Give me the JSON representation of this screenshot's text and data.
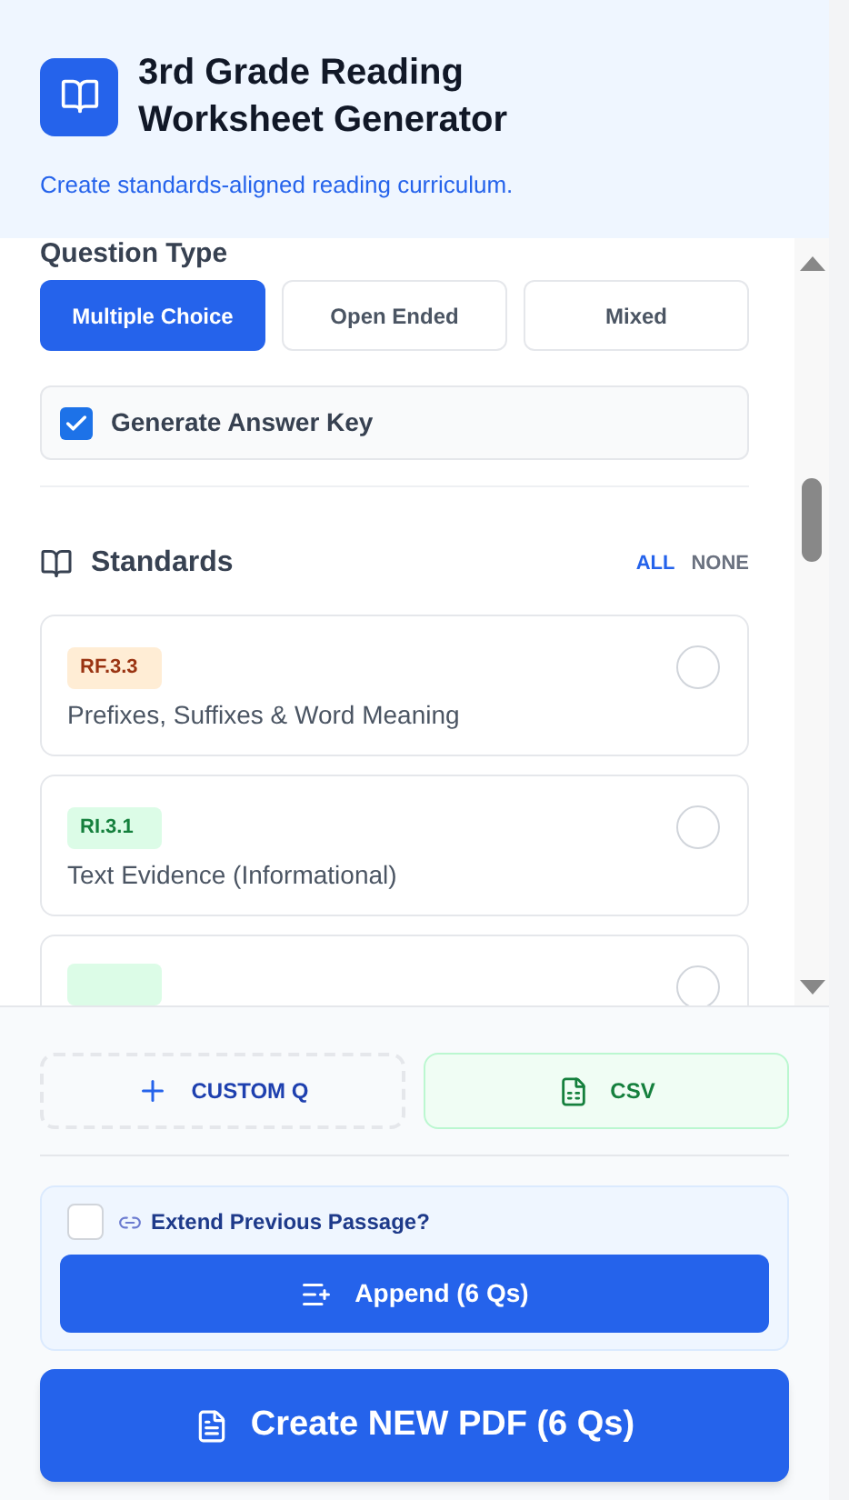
{
  "header": {
    "title": "3rd Grade Reading Worksheet Generator",
    "subtitle": "Create standards-aligned reading curriculum."
  },
  "question_type": {
    "label": "Question Type",
    "options": [
      {
        "label": "Multiple Choice",
        "selected": true
      },
      {
        "label": "Open Ended",
        "selected": false
      },
      {
        "label": "Mixed",
        "selected": false
      }
    ]
  },
  "answer_key": {
    "label": "Generate Answer Key",
    "checked": true
  },
  "standards": {
    "title": "Standards",
    "all": "ALL",
    "none": "NONE",
    "items": [
      {
        "code": "RF.3.3",
        "name": "Prefixes, Suffixes & Word Meaning",
        "color": "#ffedd5",
        "selected": false
      },
      {
        "code": "RI.3.1",
        "name": "Text Evidence (Informational)",
        "color": "#dcfce7",
        "selected": false
      },
      {
        "color": "#dcfce7",
        "selected": false
      }
    ]
  },
  "actions": {
    "custom": "CUSTOM Q",
    "csv": "CSV"
  },
  "extend": {
    "label": "Extend Previous Passage?",
    "checked": false,
    "append": "Append (6 Qs)"
  },
  "create": "Create NEW PDF (6 Qs)"
}
